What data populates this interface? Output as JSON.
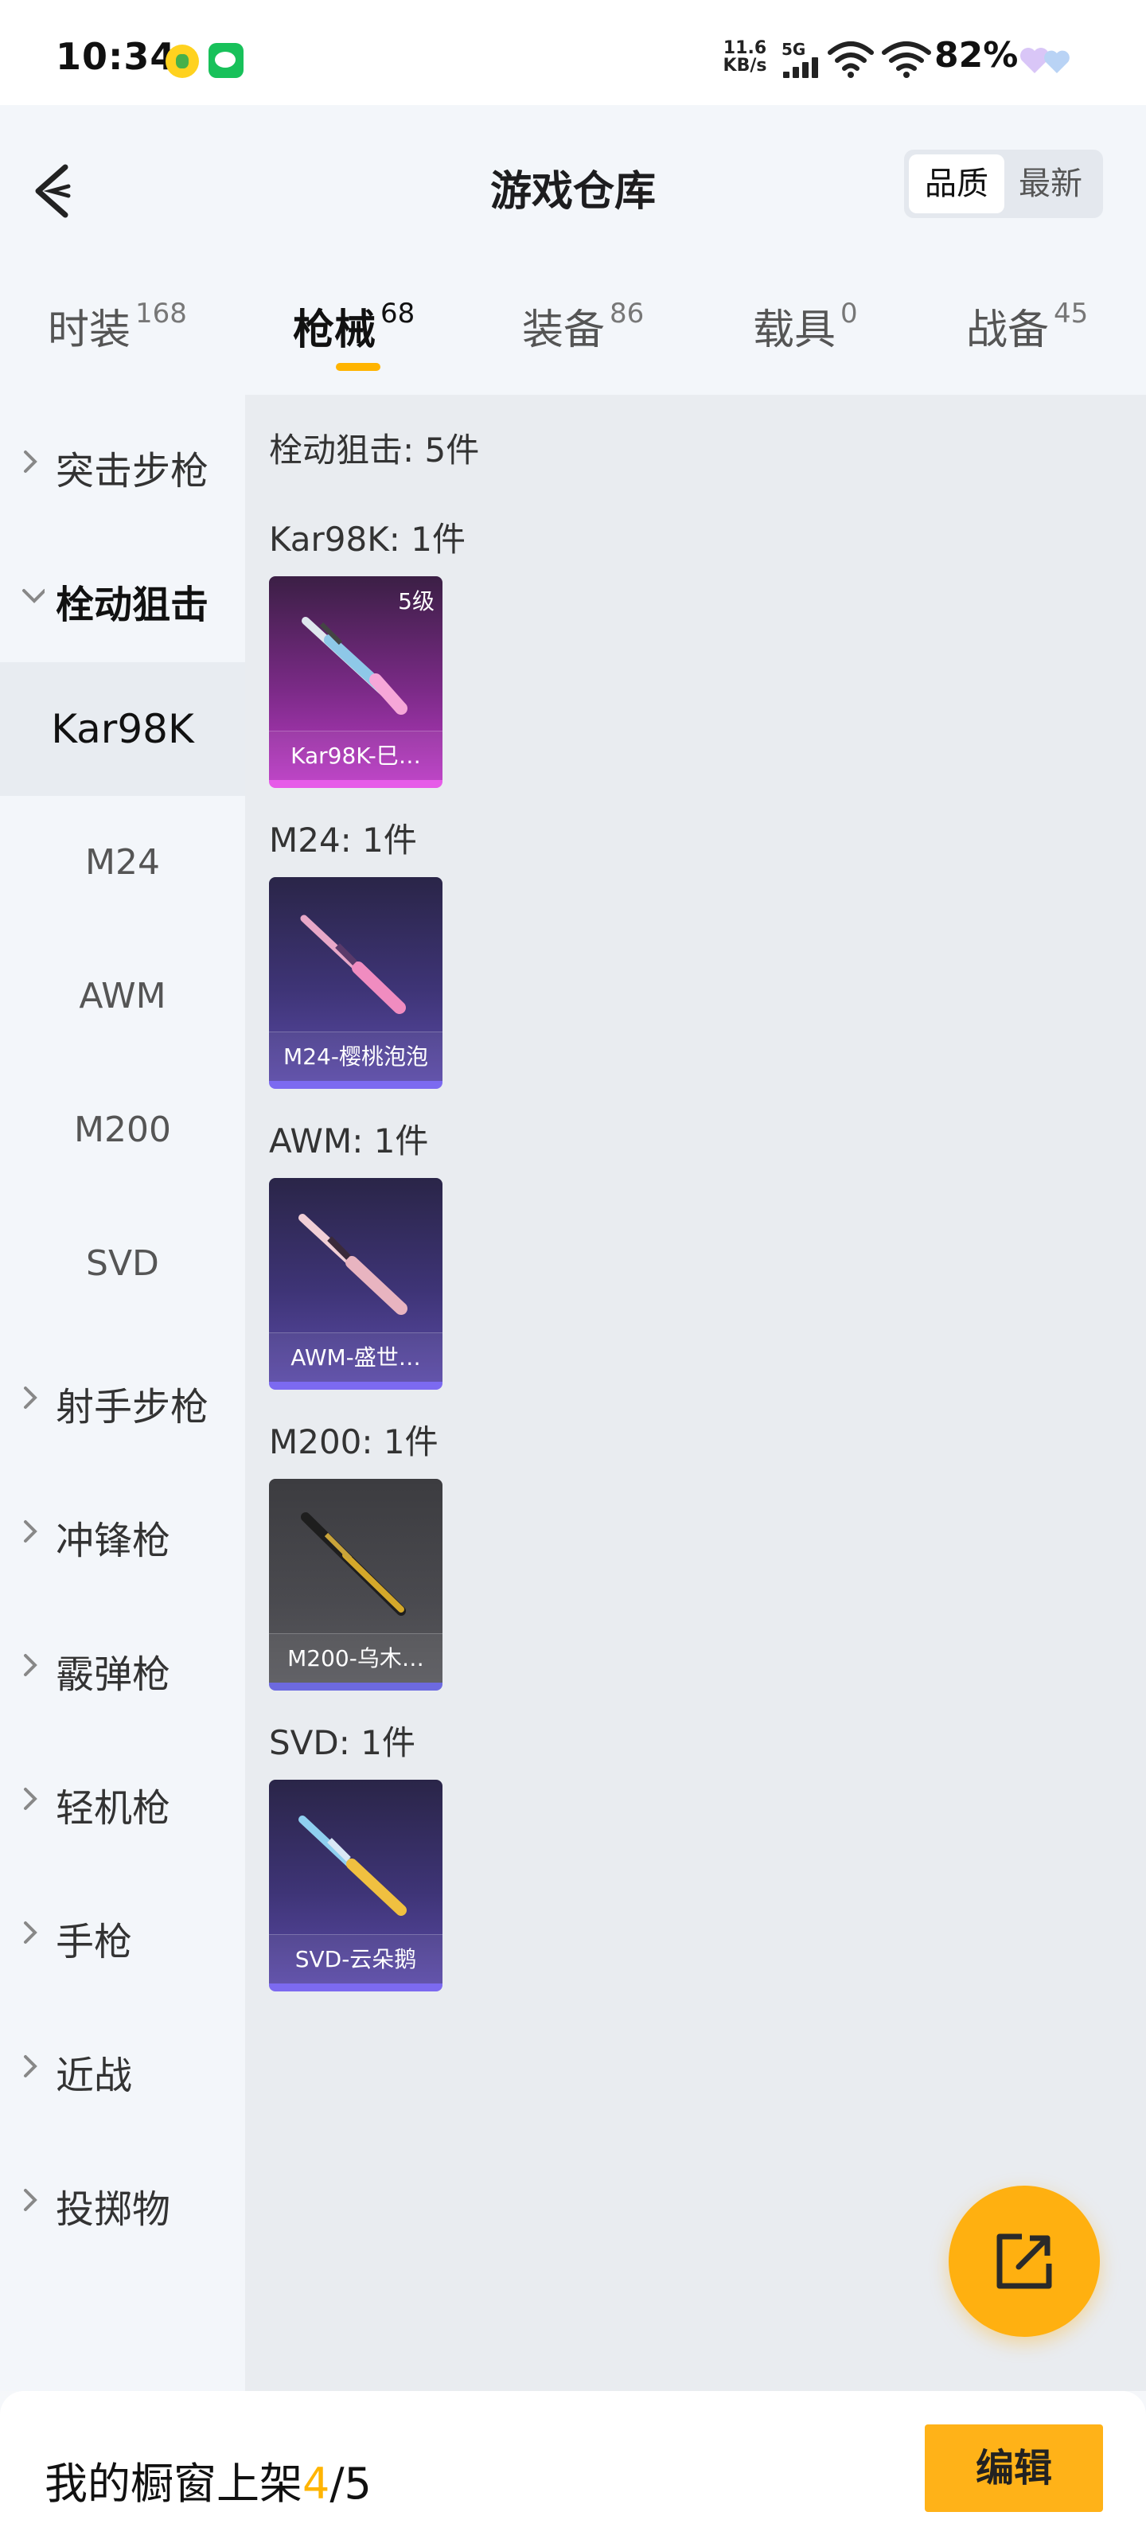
{
  "status_bar": {
    "time": "10:34",
    "net_speed_value": "11.6",
    "net_speed_unit": "KB/s",
    "network_type": "5G",
    "battery": "82%"
  },
  "header": {
    "title": "游戏仓库",
    "sort_options": [
      "品质",
      "最新"
    ],
    "sort_selected": "品质"
  },
  "tabs": [
    {
      "label": "时装",
      "count": "168"
    },
    {
      "label": "枪械",
      "count": "68"
    },
    {
      "label": "装备",
      "count": "86"
    },
    {
      "label": "载具",
      "count": "0"
    },
    {
      "label": "战备",
      "count": "45"
    }
  ],
  "active_tab": "枪械",
  "sidebar": {
    "categories_before": [
      "突击步枪"
    ],
    "open_category": "栓动狙击",
    "sub_items": [
      "Kar98K",
      "M24",
      "AWM",
      "M200",
      "SVD"
    ],
    "selected_sub": "Kar98K",
    "categories_after": [
      "射手步枪",
      "冲锋枪",
      "霰弹枪",
      "轻机枪",
      "手枪",
      "近战",
      "投掷物"
    ]
  },
  "content": {
    "section_header": "栓动狙击: 5件",
    "groups": [
      {
        "title": "Kar98K: 1件",
        "item_name": "Kar98K-巳…",
        "level": "5级",
        "rarity": "magenta"
      },
      {
        "title": "M24: 1件",
        "item_name": "M24-樱桃泡泡",
        "rarity": "purple"
      },
      {
        "title": "AWM: 1件",
        "item_name": "AWM-盛世…",
        "rarity": "purple"
      },
      {
        "title": "M200: 1件",
        "item_name": "M200-乌木…",
        "rarity": "grey"
      },
      {
        "title": "SVD: 1件",
        "item_name": "SVD-云朵鹅",
        "rarity": "purple"
      }
    ]
  },
  "bottom_bar": {
    "prefix": "我的橱窗上架",
    "count_current": "4",
    "count_sep_total": "/5",
    "edit_label": "编辑"
  },
  "colors": {
    "accent": "#ffb400",
    "magenta_rarity": "#e65ce8",
    "purple_rarity": "#7c6af0"
  },
  "icons": [
    "back-arrow-icon",
    "chevron-right-icon",
    "chevron-down-icon",
    "share-external-icon",
    "signal-icon",
    "wifi-icon"
  ]
}
